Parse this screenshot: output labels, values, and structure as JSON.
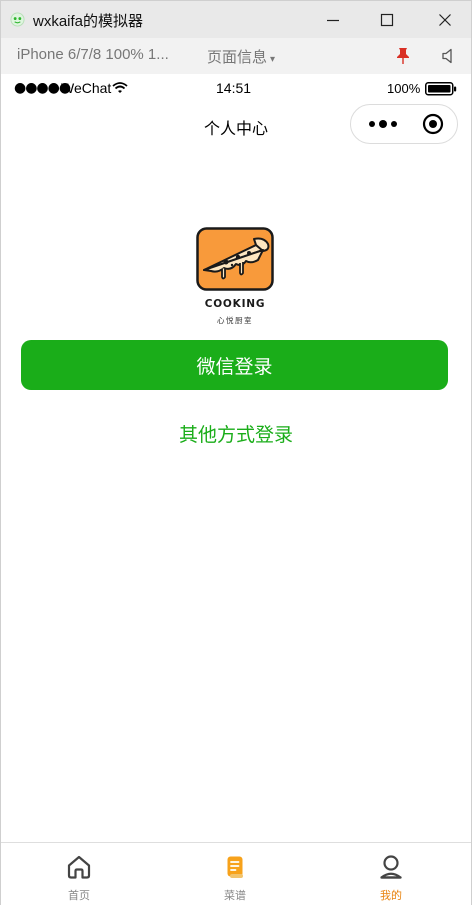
{
  "window": {
    "title": "wxkaifa的模拟器",
    "minimize_glyph": "—",
    "maximize_glyph": "☐",
    "close_glyph": "✕"
  },
  "toolbar": {
    "device": "iPhone 6/7/8 100% 1...",
    "page_info": "页面信息",
    "page_info_caret": "▾"
  },
  "status": {
    "signal": "●●●●●",
    "carrier": "WeChat",
    "time": "14:51",
    "battery": "100%"
  },
  "nav": {
    "title": "个人中心"
  },
  "logo": {
    "icon": "pizza-icon",
    "brand_text": "COOKING",
    "brand_subtext": "心悦厨室"
  },
  "actions": {
    "wechat_login": "微信登录",
    "other_login": "其他方式登录"
  },
  "tabbar": {
    "items": [
      {
        "label": "首页",
        "icon": "home-icon",
        "active": false
      },
      {
        "label": "菜谱",
        "icon": "recipe-icon",
        "active": false
      },
      {
        "label": "我的",
        "icon": "user-icon",
        "active": true
      }
    ]
  },
  "colors": {
    "primary_green": "#1aad19",
    "tab_active": "#e8830f",
    "logo_orange": "#f89a3b"
  }
}
